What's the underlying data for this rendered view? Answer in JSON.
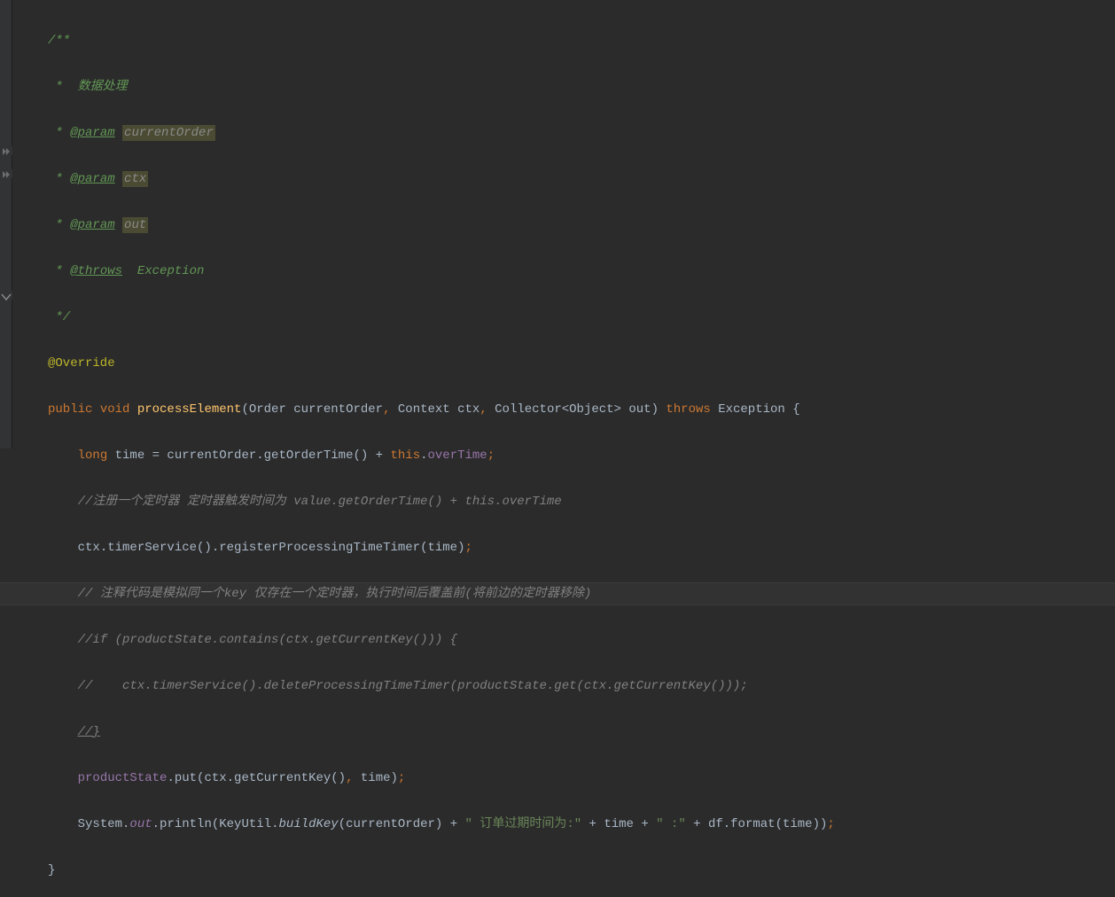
{
  "lines": {
    "l1": "/**",
    "l2_pre": " *  ",
    "l2_text": "数据处理",
    "l3_pre": " * ",
    "l3_tag": "@param",
    "l3_space": " ",
    "l3_name": "currentOrder",
    "l4_pre": " * ",
    "l4_tag": "@param",
    "l4_space": " ",
    "l4_name": "ctx",
    "l5_pre": " * ",
    "l5_tag": "@param",
    "l5_space": " ",
    "l5_name": "out",
    "l6_pre": " * ",
    "l6_tag": "@throws",
    "l6_space": "  ",
    "l6_name": "Exception",
    "l7": " */",
    "l8_ann": "@Override",
    "l9_kw1": "public ",
    "l9_kw2": "void ",
    "l9_method": "processElement",
    "l9_sig_a": "(Order currentOrder",
    "l9_sig_b": " Context ctx",
    "l9_sig_c": " Collector<Object> out) ",
    "l9_throws": "throws ",
    "l9_exc": "Exception {",
    "l10_kw": "long ",
    "l10_var": "time = currentOrder.getOrderTime() + ",
    "l10_this": "this",
    "l10_dot": ".",
    "l10_field": "overTime",
    "l11_comment": "//注册一个定时器 定时器触发时间为 value.getOrderTime() + this.overTime",
    "l12_a": "ctx.timerService().registerProcessingTimeTimer(time)",
    "l13_comment": "// 注释代码是模拟同一个key 仅存在一个定时器，执行时间后覆盖前(将前边的定时器移除)",
    "l14_comment": "//if (productState.contains(ctx.getCurrentKey())) {",
    "l15_comment": "//    ctx.timerService().deleteProcessingTimeTimer(productState.get(ctx.getCurrentKey()));",
    "l16_comment": "//}",
    "l17_a": "productState",
    "l17_b": ".put(ctx.getCurrentKey()",
    "l17_c": " time)",
    "l18_a": "System.",
    "l18_out": "out",
    "l18_b": ".println(KeyUtil.",
    "l18_buildkey": "buildKey",
    "l18_c": "(currentOrder) + ",
    "l18_str1": "\" 订单过期时间为:\"",
    "l18_d": " + time + ",
    "l18_str2": "\" :\"",
    "l18_e": " + df.format(time))",
    "l19_brace": "}"
  },
  "punct": {
    "semi": ";",
    "comma": ","
  },
  "indent": {
    "i1": "",
    "i2": "    ",
    "i3": "        "
  }
}
